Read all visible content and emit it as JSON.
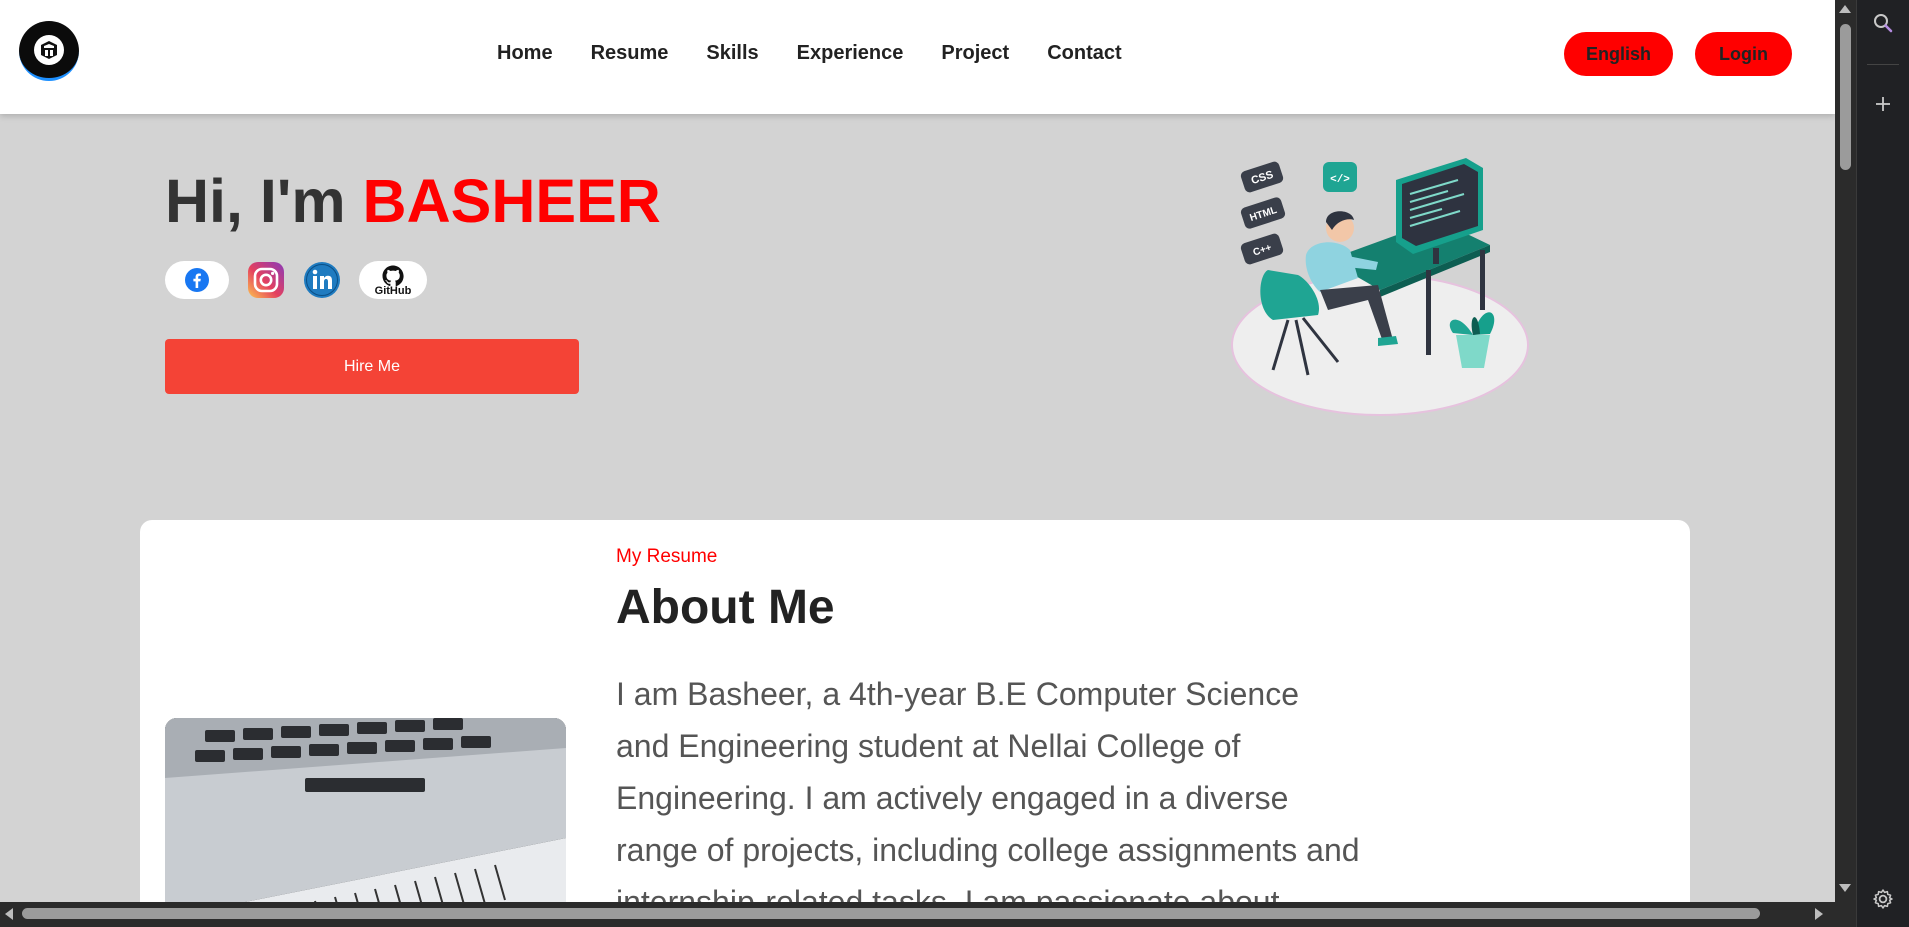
{
  "nav": {
    "items": [
      {
        "label": "Home"
      },
      {
        "label": "Resume"
      },
      {
        "label": "Skills"
      },
      {
        "label": "Experience"
      },
      {
        "label": "Project"
      },
      {
        "label": "Contact"
      }
    ],
    "english_label": "English",
    "login_label": "Login"
  },
  "hero": {
    "greeting": "Hi, I'm ",
    "name": "BASHEER",
    "hire_label": "Hire Me",
    "socials": {
      "github_label": "GitHub"
    },
    "illustration_tags": [
      "CSS",
      "HTML",
      "C++",
      "</>"
    ]
  },
  "about": {
    "kicker": "My Resume",
    "title": "About Me",
    "text": "I am Basheer, a 4th-year B.E Computer Science and Engineering student at Nellai College of Engineering. I am actively engaged in a diverse range of projects, including college assignments and internship-related tasks. I am passionate about"
  },
  "icons": {
    "logo": "brand-logo-icon",
    "facebook": "facebook-icon",
    "instagram": "instagram-icon",
    "linkedin": "linkedin-icon",
    "github": "github-icon",
    "search": "search-icon",
    "add": "plus-icon",
    "settings": "gear-icon"
  },
  "colors": {
    "accent": "#ff0000",
    "hire_button": "#f44336",
    "page_bg": "#d3d3d3"
  }
}
